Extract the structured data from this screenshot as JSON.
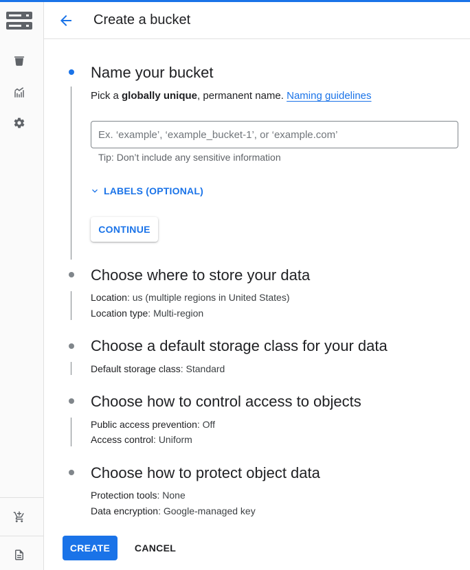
{
  "header": {
    "title": "Create a bucket",
    "back_icon": "arrow-back-icon"
  },
  "rail": {
    "logo_icon": "storage-logo-icon",
    "items": [
      {
        "icon": "bucket-icon"
      },
      {
        "icon": "monitoring-chart-icon"
      },
      {
        "icon": "settings-gear-icon"
      }
    ],
    "bottom_items": [
      {
        "icon": "marketplace-cart-icon"
      },
      {
        "icon": "release-notes-icon"
      }
    ]
  },
  "step1": {
    "title": "Name your bucket",
    "desc_prefix": "Pick a ",
    "desc_bold": "globally unique",
    "desc_suffix": ", permanent name. ",
    "link": "Naming guidelines",
    "input_value": "",
    "input_placeholder": "Ex. ‘example’, ‘example_bucket-1’, or ‘example.com’",
    "tip": "Tip: Don’t include any sensitive information",
    "labels_toggle": "LABELS (OPTIONAL)",
    "continue_label": "CONTINUE"
  },
  "step2": {
    "title": "Choose where to store your data",
    "rows": [
      {
        "label": "Location",
        "value": ": us (multiple regions in United States)"
      },
      {
        "label": "Location type",
        "value": ": Multi-region"
      }
    ]
  },
  "step3": {
    "title": "Choose a default storage class for your data",
    "rows": [
      {
        "label": "Default storage class",
        "value": ": Standard"
      }
    ]
  },
  "step4": {
    "title": "Choose how to control access to objects",
    "rows": [
      {
        "label": "Public access prevention",
        "value": ": Off"
      },
      {
        "label": "Access control",
        "value": ": Uniform"
      }
    ]
  },
  "step5": {
    "title": "Choose how to protect object data",
    "rows": [
      {
        "label": "Protection tools",
        "value": ": None"
      },
      {
        "label": "Data encryption",
        "value": ": Google-managed key"
      }
    ]
  },
  "footer": {
    "create_label": "CREATE",
    "cancel_label": "CANCEL"
  },
  "colors": {
    "accent": "#1a73e8",
    "text": "#202124",
    "muted": "#5f6368"
  }
}
